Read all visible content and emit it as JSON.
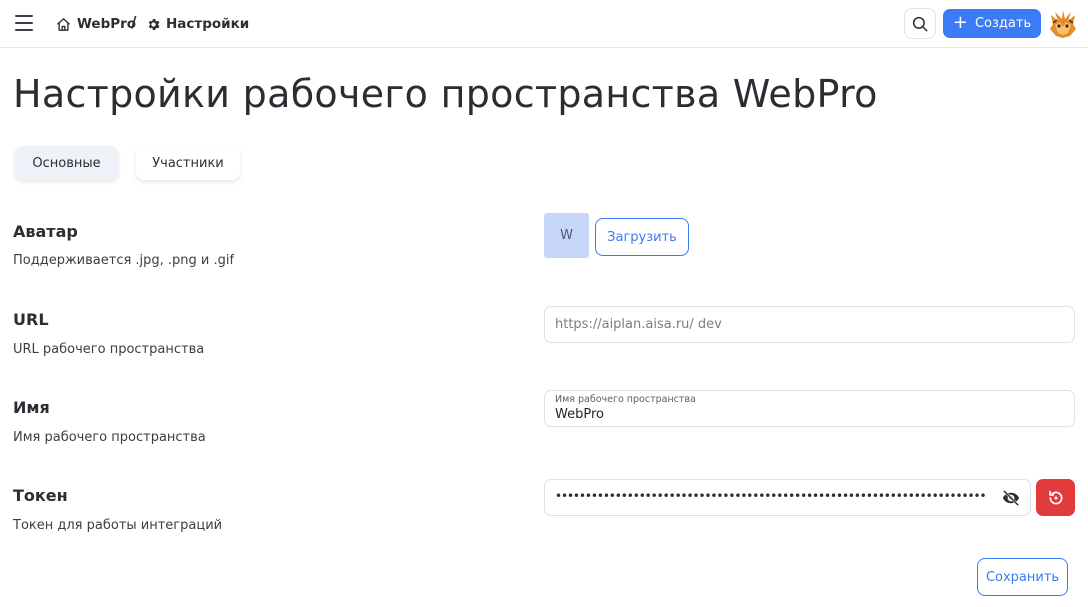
{
  "header": {
    "workspace_crumb": "WebPro",
    "separator": "/",
    "settings_crumb": "Настройки",
    "create_label": "Создать",
    "accent_color": "#3b7bf5"
  },
  "page": {
    "title": "Настройки рабочего пространства WebPro"
  },
  "tabs": [
    {
      "label": "Основные",
      "active": true
    },
    {
      "label": "Участники",
      "active": false
    }
  ],
  "avatar_section": {
    "title": "Аватар",
    "description": "Поддерживается .jpg, .png и .gif",
    "avatar_letter": "W",
    "upload_label": "Загрузить"
  },
  "url_section": {
    "title": "URL",
    "description": "URL рабочего пространства",
    "value": "https://aiplan.aisa.ru/ dev"
  },
  "name_section": {
    "title": "Имя",
    "description": "Имя рабочего пространства",
    "field_label": "Имя рабочего пространства",
    "value": "WebPro"
  },
  "token_section": {
    "title": "Токен",
    "description": "Токен для работы интеграций",
    "masked_value": "••••••••••••••••••••••••••••••••••••••••••••••••••••••••••••••••••••••••",
    "regen_color": "#e23b3b"
  },
  "footer": {
    "save_label": "Сохранить"
  },
  "icons": {
    "menu": "hamburger-icon",
    "home": "home-icon",
    "settings": "gear-icon",
    "search": "search-icon",
    "create": "plus-icon",
    "visibility": "eye-off-icon",
    "regenerate": "regenerate-icon"
  }
}
